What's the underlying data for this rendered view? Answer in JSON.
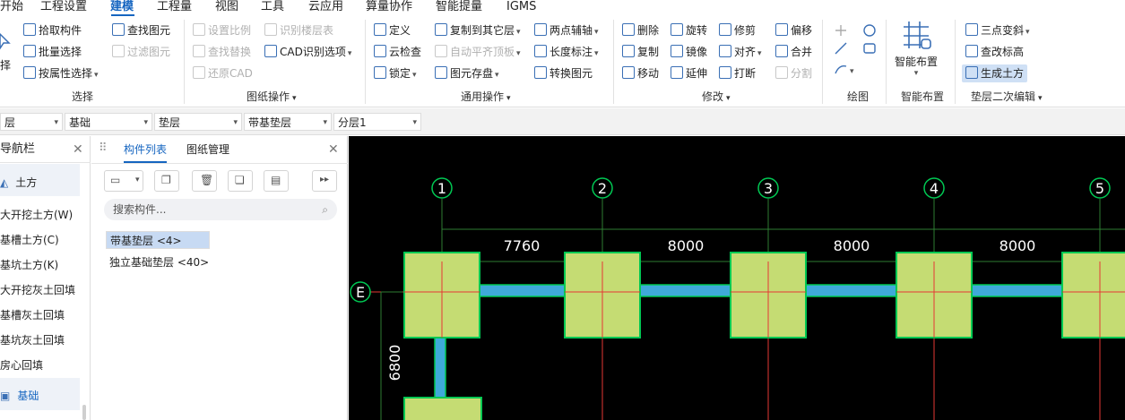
{
  "menu": {
    "items": [
      "开始",
      "工程设置",
      "建模",
      "工程量",
      "视图",
      "工具",
      "云应用",
      "算量协作",
      "智能提量",
      "IGMS"
    ],
    "active": "建模"
  },
  "ribbon": {
    "select_group": {
      "title": "选择",
      "big_button_label": "择",
      "pick_component": "拾取构件",
      "batch_select": "批量选择",
      "by_attribute": "按属性选择",
      "find_element": "查找图元",
      "filter_element": "过滤图元"
    },
    "drawing_group": {
      "title": "图纸操作",
      "set_scale": "设置比例",
      "find_replace": "查找替换",
      "restore_cad": "还原CAD",
      "identify_floor_table": "识别楼层表",
      "cad_options": "CAD识别选项"
    },
    "common_group": {
      "title": "通用操作",
      "define": "定义",
      "cloud_check": "云检查",
      "lock": "锁定",
      "copy_to_other_layer": "复制到其它层",
      "auto_align_slab": "自动平齐顶板",
      "element_save": "图元存盘",
      "two_point_axis": "两点辅轴",
      "length_dim": "长度标注",
      "convert_element": "转换图元"
    },
    "modify_group": {
      "title": "修改",
      "delete": "删除",
      "copy": "复制",
      "move": "移动",
      "rotate": "旋转",
      "mirror": "镜像",
      "extend": "延伸",
      "trim": "修剪",
      "align": "对齐",
      "break": "打断",
      "offset": "偏移",
      "merge": "合并",
      "split": "分割"
    },
    "draw_group": {
      "title": "绘图"
    },
    "smart_group": {
      "title": "智能布置",
      "button": "智能布置"
    },
    "cushion_group": {
      "title": "垫层二次编辑",
      "three_point_slope": "三点变斜",
      "check_elevation": "查改标高",
      "generate_earthwork": "生成土方"
    }
  },
  "selectors": {
    "floor": "层",
    "category": "基础",
    "type": "垫层",
    "component": "带基垫层",
    "layer": "分层1"
  },
  "nav": {
    "title": "导航栏",
    "earthwork": "土方",
    "items": [
      "大开挖土方(W)",
      "基槽土方(C)",
      "基坑土方(K)",
      "大开挖灰土回填",
      "基槽灰土回填",
      "基坑灰土回填",
      "房心回填"
    ],
    "foundation": "基础"
  },
  "component_panel": {
    "tab_list": "构件列表",
    "tab_drawing": "图纸管理",
    "search_placeholder": "搜索构件...",
    "items": [
      "带基垫层 <4>",
      "独立基础垫层 <40>"
    ]
  },
  "canvas": {
    "axis_labels": [
      "1",
      "2",
      "3",
      "4",
      "5"
    ],
    "row_label": "E",
    "dims": [
      "7760",
      "8000",
      "8000",
      "8000"
    ],
    "vertical_dim": "6800",
    "colors": {
      "background": "#000000",
      "pad_fill": "#c5dc73",
      "pad_stroke": "#00c853",
      "strip": "#3fa9d9",
      "axis_line": "#e53935",
      "dim_line": "#2e7d32",
      "axis_circle": "#ffffff"
    }
  }
}
